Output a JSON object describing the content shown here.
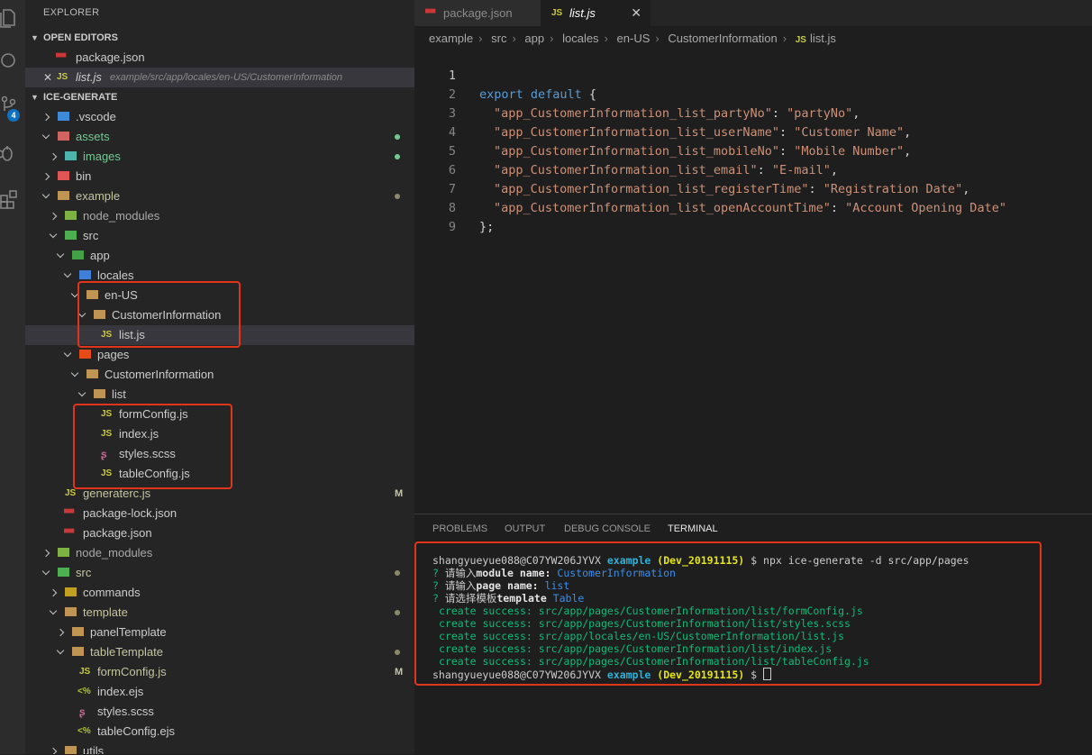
{
  "explorer": {
    "title": "EXPLORER",
    "open_editors_label": "OPEN EDITORS",
    "open_editors": [
      {
        "name": "package.json",
        "path": ""
      },
      {
        "name": "list.js",
        "path": "example/src/app/locales/en-US/CustomerInformation"
      }
    ],
    "project_label": "ICE-GENERATE",
    "tree": [
      {
        "name": ".vscode"
      },
      {
        "name": "assets"
      },
      {
        "name": "images"
      },
      {
        "name": "bin"
      },
      {
        "name": "example"
      },
      {
        "name": "node_modules"
      },
      {
        "name": "src"
      },
      {
        "name": "app"
      },
      {
        "name": "locales"
      },
      {
        "name": "en-US"
      },
      {
        "name": "CustomerInformation"
      },
      {
        "name": "list.js"
      },
      {
        "name": "pages"
      },
      {
        "name": "CustomerInformation"
      },
      {
        "name": "list"
      },
      {
        "name": "formConfig.js"
      },
      {
        "name": "index.js"
      },
      {
        "name": "styles.scss"
      },
      {
        "name": "tableConfig.js"
      },
      {
        "name": "generaterc.js",
        "status": "M"
      },
      {
        "name": "package-lock.json"
      },
      {
        "name": "package.json"
      },
      {
        "name": "node_modules"
      },
      {
        "name": "src"
      },
      {
        "name": "commands"
      },
      {
        "name": "template"
      },
      {
        "name": "panelTemplate"
      },
      {
        "name": "tableTemplate"
      },
      {
        "name": "formConfig.js",
        "status": "M"
      },
      {
        "name": "index.ejs"
      },
      {
        "name": "styles.scss"
      },
      {
        "name": "tableConfig.ejs"
      },
      {
        "name": "utils"
      }
    ],
    "badge_count": "4"
  },
  "tabs": [
    {
      "label": "package.json",
      "icon": "json-icon"
    },
    {
      "label": "list.js",
      "icon": "js-icon",
      "close": "✕"
    }
  ],
  "breadcrumb": [
    "example",
    "src",
    "app",
    "locales",
    "en-US",
    "CustomerInformation",
    "list.js"
  ],
  "editor": {
    "line_numbers": [
      "1",
      "2",
      "3",
      "4",
      "5",
      "6",
      "7",
      "8",
      "9"
    ],
    "export_kw": "export default",
    "open_brace": " {",
    "entries": [
      {
        "key": "\"app_CustomerInformation_list_partyNo\"",
        "value": "\"partyNo\""
      },
      {
        "key": "\"app_CustomerInformation_list_userName\"",
        "value": "\"Customer Name\""
      },
      {
        "key": "\"app_CustomerInformation_list_mobileNo\"",
        "value": "\"Mobile Number\""
      },
      {
        "key": "\"app_CustomerInformation_list_email\"",
        "value": "\"E-mail\""
      },
      {
        "key": "\"app_CustomerInformation_list_registerTime\"",
        "value": "\"Registration Date\""
      },
      {
        "key": "\"app_CustomerInformation_list_openAccountTime\"",
        "value": "\"Account Opening Date\""
      }
    ],
    "close": "};"
  },
  "panel": {
    "tabs": [
      "PROBLEMS",
      "OUTPUT",
      "DEBUG CONSOLE",
      "TERMINAL"
    ],
    "terminal": {
      "user_host": "shangyueyue088@C07YW206JYVX",
      "dir": "example",
      "branch": "(Dev_20191115)",
      "prompt": "$",
      "command": "npx ice-generate -d src/app/pages",
      "q1_prefix": "请输入",
      "q1_bold": "module name:",
      "q1_answer": "CustomerInformation",
      "q2_prefix": "请输入",
      "q2_bold": "page name:",
      "q2_answer": "list",
      "q3_prefix": "请选择模板",
      "q3_bold": "template",
      "q3_answer": "Table",
      "qmark": "?",
      "created": [
        "create success: src/app/pages/CustomerInformation/list/formConfig.js",
        "create success: src/app/pages/CustomerInformation/list/styles.scss",
        "create success: src/app/locales/en-US/CustomerInformation/list.js",
        "create success: src/app/pages/CustomerInformation/list/index.js",
        "create success: src/app/pages/CustomerInformation/list/tableConfig.js"
      ]
    }
  }
}
